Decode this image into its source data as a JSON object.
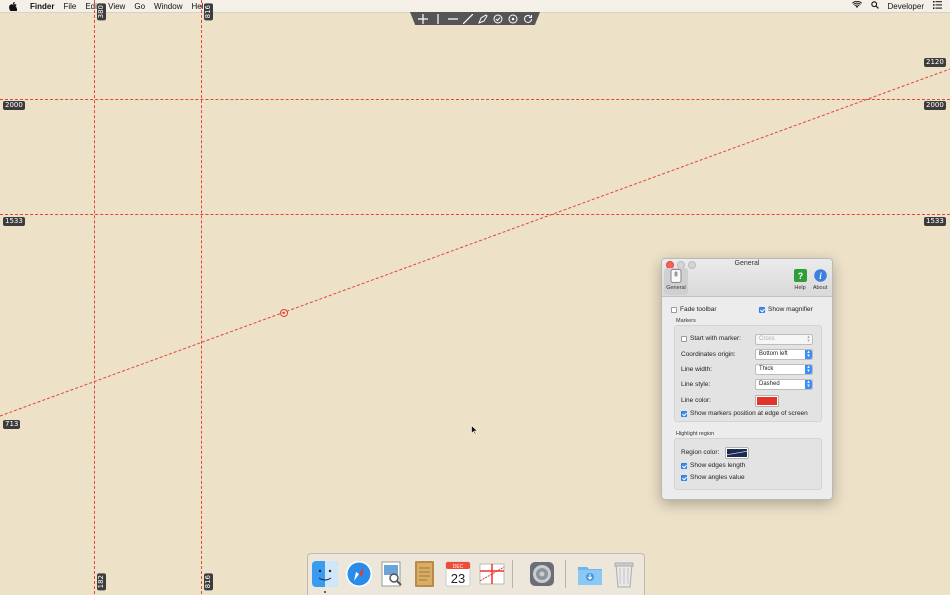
{
  "menubar": {
    "app": "Finder",
    "items": [
      "File",
      "Edit",
      "View",
      "Go",
      "Window",
      "Help"
    ],
    "user": "Developer"
  },
  "guides": {
    "vertical_labels": {
      "v1_top": "380",
      "v1_bottom": "182",
      "v2_top": "816",
      "v2_bottom": "816"
    },
    "horizontal_labels": {
      "h1_left": "2000",
      "h1_right": "2000",
      "h2_left": "1533",
      "h2_right": "1533"
    },
    "diagonal_labels": {
      "start": "713",
      "end": "2120"
    }
  },
  "prefs": {
    "window_title": "General",
    "tabs": {
      "general": "General",
      "help": "Help",
      "about": "About"
    },
    "fade_toolbar": {
      "label": "Fade toolbar",
      "checked": false
    },
    "show_magnifier": {
      "label": "Show magnifier",
      "checked": true
    },
    "markers": {
      "title": "Markers",
      "start_with_marker": {
        "label": "Start with marker:",
        "checked": false,
        "value": "Cross"
      },
      "coordinates_origin": {
        "label": "Coordinates origin:",
        "value": "Bottom left"
      },
      "line_width": {
        "label": "Line width:",
        "value": "Thick"
      },
      "line_style": {
        "label": "Line style:",
        "value": "Dashed"
      },
      "line_color": {
        "label": "Line color:",
        "color": "#e3342a"
      },
      "show_markers_position": {
        "label": "Show markers position at edge of screen",
        "checked": true
      }
    },
    "highlight": {
      "title": "Highlight region",
      "region_color": {
        "label": "Region color:",
        "color": "#1d2a52"
      },
      "show_edges_length": {
        "label": "Show edges length",
        "checked": true
      },
      "show_angles_value": {
        "label": "Show angles value",
        "checked": true
      }
    }
  },
  "colors": {
    "desktop": "#ede1c8",
    "guide_line": "#e0463a",
    "accent": "#3b8ef6"
  },
  "dock": {
    "icons": [
      "finder-icon",
      "safari-icon",
      "preview-icon",
      "notes-icon",
      "calendar-icon",
      "ruler-app-icon",
      "system-preferences-icon",
      "downloads-folder-icon",
      "trash-icon"
    ],
    "calendar_month": "DEC",
    "calendar_day": "23"
  }
}
